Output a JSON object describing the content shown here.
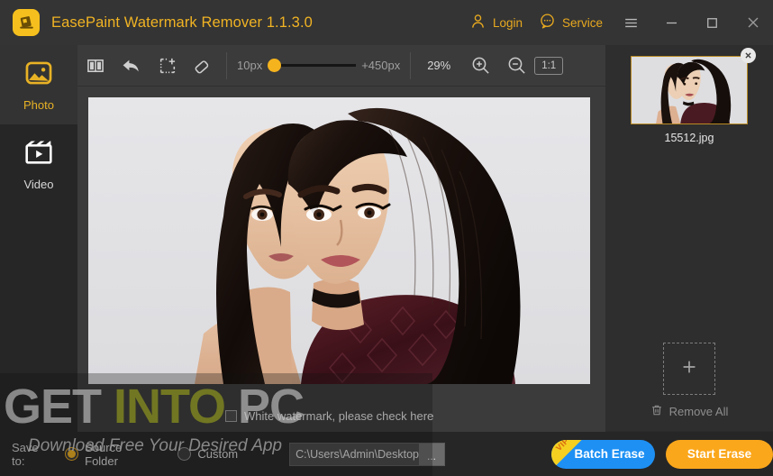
{
  "window": {
    "title": "EasePaint Watermark Remover  1.1.3.0",
    "logo_icon": "app-logo-icon",
    "login_label": "Login",
    "login_icon": "user-icon",
    "service_label": "Service",
    "service_icon": "chat-bubble-icon",
    "menu_icon": "hamburger-menu-icon",
    "minimize_icon": "minimize-icon",
    "maximize_icon": "maximize-icon",
    "close_icon": "close-icon"
  },
  "sidebar": {
    "items": [
      {
        "label": "Photo",
        "icon": "photo-icon",
        "active": true
      },
      {
        "label": "Video",
        "icon": "video-clapperboard-icon",
        "active": false
      }
    ]
  },
  "toolbar": {
    "compare_icon": "split-compare-icon",
    "undo_icon": "undo-arrow-icon",
    "marquee_icon": "add-selection-icon",
    "eraser_icon": "eraser-icon",
    "brush_min_label": "10px",
    "brush_max_label": "+450px",
    "zoom_level": "29%",
    "zoom_in_icon": "zoom-in-icon",
    "zoom_out_icon": "zoom-out-icon",
    "actual_size_label": "1:1"
  },
  "canvas": {
    "white_watermark_label": "White watermark, please check here",
    "white_watermark_checked": false
  },
  "file_panel": {
    "thumbnail_name": "15512.jpg",
    "thumbnail_close_icon": "remove-thumbnail-icon",
    "add_icon": "plus-icon",
    "remove_all_label": "Remove All",
    "remove_all_icon": "trash-icon"
  },
  "bottom_bar": {
    "save_to_label": "Save to:",
    "option_source_label": "Source Folder",
    "option_custom_label": "Custom",
    "selected_option": "Source Folder",
    "path_value": "C:\\Users\\Admin\\Desktop",
    "browse_label": "...",
    "batch_erase_label": "Batch Erase",
    "batch_vip_badge": "VIP",
    "start_erase_label": "Start Erase"
  },
  "watermark": {
    "part1": "GET ",
    "part2": "INTO ",
    "part3": "PC",
    "subtitle": "Download Free Your Desired App"
  },
  "colors": {
    "accent_gold": "#e8a91f",
    "brand_yellow": "#f5c01e",
    "batch_blue": "#1e90f4",
    "start_orange": "#fba71b",
    "watermark_olive": "#9aa21c"
  }
}
